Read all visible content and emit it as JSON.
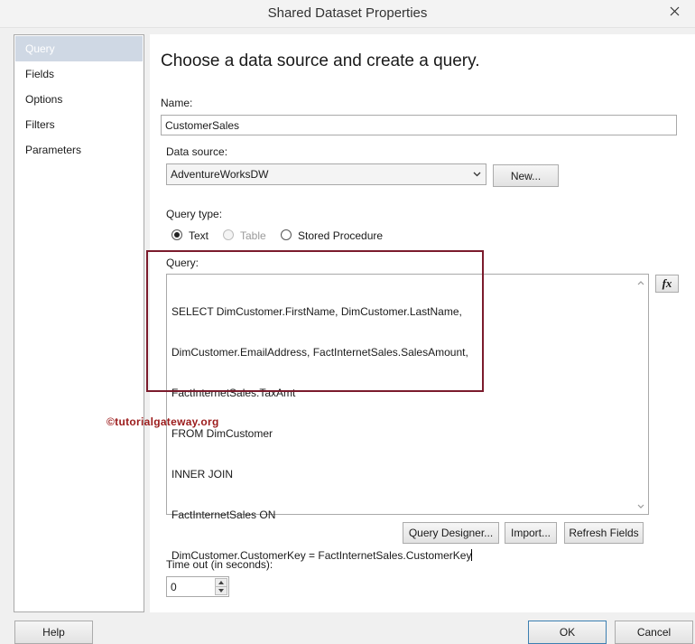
{
  "window": {
    "title": "Shared Dataset Properties"
  },
  "sidebar": {
    "items": [
      {
        "label": "Query",
        "active": true
      },
      {
        "label": "Fields"
      },
      {
        "label": "Options"
      },
      {
        "label": "Filters"
      },
      {
        "label": "Parameters"
      }
    ]
  },
  "main": {
    "heading": "Choose a data source and create a query.",
    "name_label": "Name:",
    "name_value": "CustomerSales",
    "datasource_label": "Data source:",
    "datasource_value": "AdventureWorksDW",
    "new_button": "New...",
    "querytype_label": "Query type:",
    "querytype_options": [
      {
        "label": "Text",
        "checked": true
      },
      {
        "label": "Table",
        "disabled": true
      },
      {
        "label": "Stored Procedure"
      }
    ],
    "query_label": "Query:",
    "query_lines": [
      "SELECT DimCustomer.FirstName, DimCustomer.LastName,",
      "DimCustomer.EmailAddress, FactInternetSales.SalesAmount,",
      "FactInternetSales.TaxAmt",
      "FROM DimCustomer",
      "INNER JOIN",
      "FactInternetSales ON",
      "DimCustomer.CustomerKey = FactInternetSales.CustomerKey"
    ],
    "fx_label": "fx",
    "query_designer_button": "Query Designer...",
    "import_button": "Import...",
    "refresh_fields_button": "Refresh Fields",
    "timeout_label": "Time out (in seconds):",
    "timeout_value": "0",
    "watermark": "©tutorialgateway.org"
  },
  "footer": {
    "help_button": "Help",
    "ok_button": "OK",
    "cancel_button": "Cancel"
  },
  "colors": {
    "active_nav": "#cfd8e4",
    "highlight_border": "#7b1b2c",
    "watermark": "#9b1b1b"
  }
}
